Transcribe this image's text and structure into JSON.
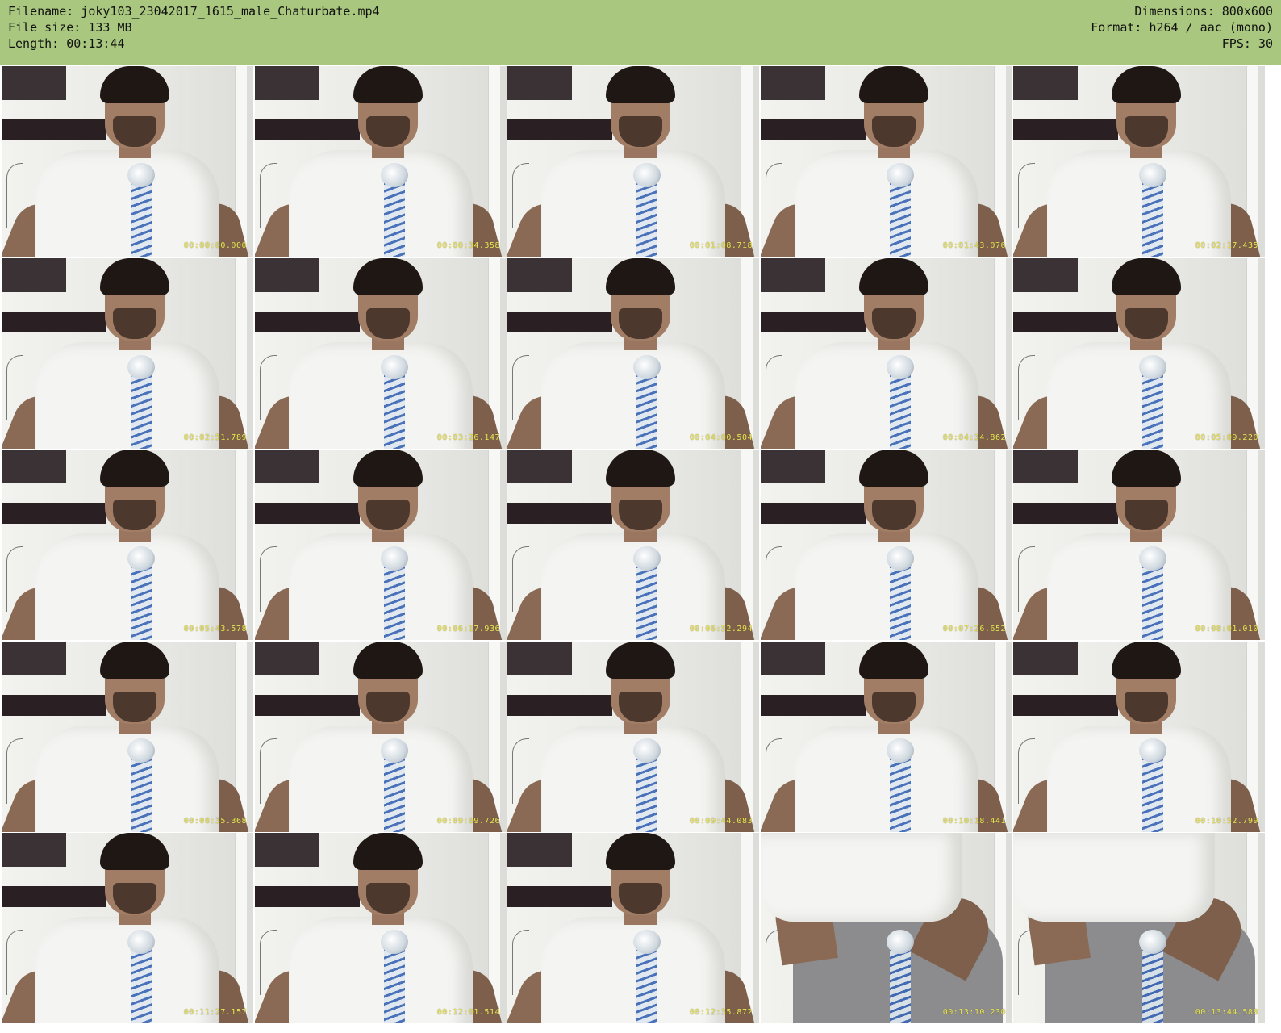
{
  "header": {
    "filename_line": "Filename: joky103_23042017_1615_male_Chaturbate.mp4",
    "filesize_line": "File size: 133 MB",
    "length_line": "Length: 00:13:44",
    "dimensions_line": "Dimensions: 800x600",
    "format_line": "Format: h264 / aac (mono)",
    "fps_line": "FPS: 30",
    "bg_color": "#a9c77e"
  },
  "thumbnails": [
    {
      "timestamp": "00:00:00.000",
      "scene": "seated"
    },
    {
      "timestamp": "00:00:34.358",
      "scene": "seated"
    },
    {
      "timestamp": "00:01:08.718",
      "scene": "seated"
    },
    {
      "timestamp": "00:01:43.076",
      "scene": "seated"
    },
    {
      "timestamp": "00:02:17.435",
      "scene": "seated"
    },
    {
      "timestamp": "00:02:51.789",
      "scene": "seated"
    },
    {
      "timestamp": "00:03:26.147",
      "scene": "seated"
    },
    {
      "timestamp": "00:04:00.504",
      "scene": "seated"
    },
    {
      "timestamp": "00:04:34.862",
      "scene": "seated"
    },
    {
      "timestamp": "00:05:09.220",
      "scene": "seated"
    },
    {
      "timestamp": "00:05:43.578",
      "scene": "seated"
    },
    {
      "timestamp": "00:06:17.936",
      "scene": "seated"
    },
    {
      "timestamp": "00:06:52.294",
      "scene": "seated"
    },
    {
      "timestamp": "00:07:26.652",
      "scene": "seated"
    },
    {
      "timestamp": "00:08:01.010",
      "scene": "seated"
    },
    {
      "timestamp": "00:08:35.368",
      "scene": "seated"
    },
    {
      "timestamp": "00:09:09.726",
      "scene": "seated"
    },
    {
      "timestamp": "00:09:44.083",
      "scene": "seated"
    },
    {
      "timestamp": "00:10:18.441",
      "scene": "seated"
    },
    {
      "timestamp": "00:10:52.799",
      "scene": "seated"
    },
    {
      "timestamp": "00:11:27.157",
      "scene": "seated"
    },
    {
      "timestamp": "00:12:01.514",
      "scene": "seated"
    },
    {
      "timestamp": "00:12:35.872",
      "scene": "seated"
    },
    {
      "timestamp": "00:13:10.230",
      "scene": "standing"
    },
    {
      "timestamp": "00:13:44.588",
      "scene": "standing"
    }
  ]
}
